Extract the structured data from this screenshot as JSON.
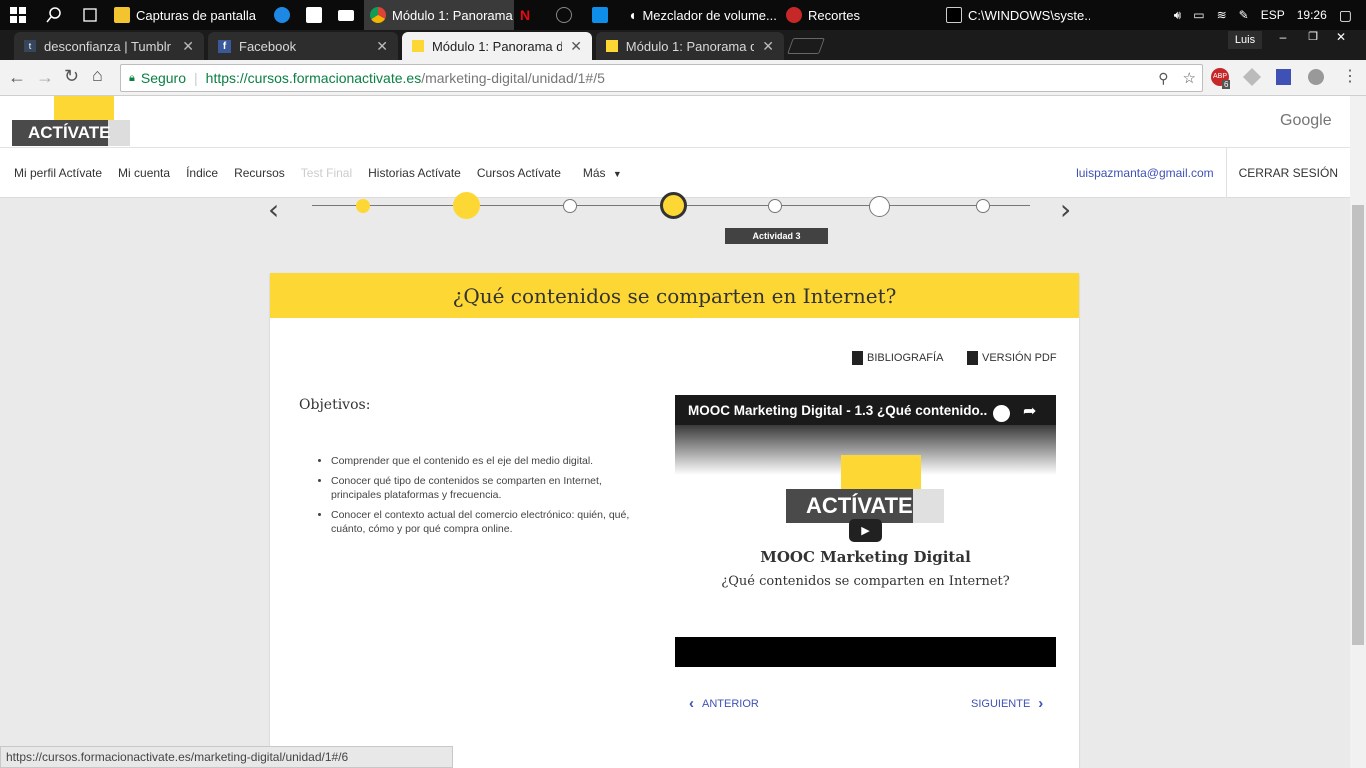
{
  "taskbar": {
    "items": [
      "Capturas de pantalla",
      "Módulo 1: Panorama ...",
      "Mezclador de volume...",
      "Recortes",
      "C:\\WINDOWS\\syste..."
    ],
    "lang": "ESP",
    "time": "19:26"
  },
  "tabs": [
    {
      "label": "desconfianza | Tumblr"
    },
    {
      "label": "Facebook"
    },
    {
      "label": "Módulo 1: Panorama del"
    },
    {
      "label": "Módulo 1: Panorama del"
    }
  ],
  "window": {
    "user": "Luis"
  },
  "address": {
    "secure": "Seguro",
    "url_host": "https://cursos.formacionactivate.es",
    "url_path": "/marketing-digital/unidad/1#/5",
    "ext_badge": "6"
  },
  "header": {
    "logo": "ACTÍVATE",
    "google": "Google"
  },
  "nav": {
    "items": [
      "Mi perfil Actívate",
      "Mi cuenta",
      "Índice",
      "Recursos",
      "Test Final",
      "Historias Actívate",
      "Cursos Actívate",
      "Más"
    ],
    "email": "luispazmanta@gmail.com",
    "logout": "CERRAR SESIÓN"
  },
  "progress": {
    "tooltip": "Actividad 3"
  },
  "card": {
    "title": "¿Qué contenidos se comparten en Internet?",
    "bibliografia": "BIBLIOGRAFÍA",
    "pdf": "VERSIÓN PDF",
    "objetivos": "Objetivos:",
    "bullets": [
      "Comprender que el contenido es el eje del medio digital.",
      "Conocer qué tipo de contenidos se comparten en Internet, principales plataformas y frecuencia.",
      "Conocer el contexto actual del comercio electrónico: quién, qué, cuánto, cómo y por qué compra online."
    ],
    "video": {
      "title": "MOOC Marketing Digital - 1.3 ¿Qué contenido...",
      "logo": "ACTÍVATE",
      "heading": "MOOC Marketing Digital",
      "subtitle": "¿Qué contenidos se comparten en Internet?"
    },
    "prev": "ANTERIOR",
    "next": "SIGUIENTE"
  },
  "status": {
    "url": "https://cursos.formacionactivate.es/marketing-digital/unidad/1#/6"
  },
  "colors": {
    "accent": "#fdd835",
    "link": "#3f51b5"
  }
}
